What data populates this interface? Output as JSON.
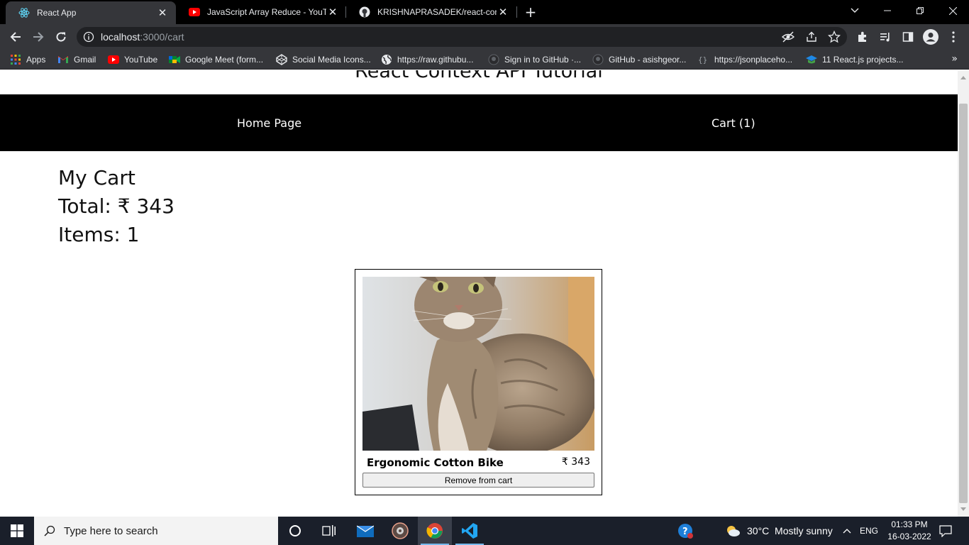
{
  "browser": {
    "tabs": [
      {
        "title": "React App",
        "icon": "react-icon",
        "active": true
      },
      {
        "title": "JavaScript Array Reduce - YouTube",
        "icon": "youtube-icon",
        "active": false
      },
      {
        "title": "KRISHNAPRASADEK/react-context",
        "icon": "github-icon",
        "active": false
      }
    ],
    "url_host": "localhost",
    "url_path": ":3000/cart",
    "bookmarks": [
      {
        "label": "Apps",
        "icon": "apps-grid-icon"
      },
      {
        "label": "Gmail",
        "icon": "gmail-icon"
      },
      {
        "label": "YouTube",
        "icon": "youtube-icon"
      },
      {
        "label": "Google Meet (form...",
        "icon": "google-meet-icon"
      },
      {
        "label": "Social Media Icons...",
        "icon": "codepen-icon"
      },
      {
        "label": "https://raw.githubu...",
        "icon": "globe-icon"
      },
      {
        "label": "Sign in to GitHub ·...",
        "icon": "github-icon"
      },
      {
        "label": "GitHub - asishgeor...",
        "icon": "github-icon"
      },
      {
        "label": "https://jsonplaceho...",
        "icon": "json-icon"
      },
      {
        "label": "11 React.js projects...",
        "icon": "graduation-cap-icon"
      }
    ]
  },
  "page": {
    "heading": "React Context API Tutorial",
    "nav": {
      "home": "Home Page",
      "cart": "Cart (1)"
    },
    "cart": {
      "title": "My Cart",
      "total": "Total: ₹ 343",
      "items": "Items: 1"
    },
    "product": {
      "name": "Ergonomic Cotton Bike",
      "price": "₹ 343",
      "button": "Remove from cart",
      "image": "cat-photo"
    }
  },
  "taskbar": {
    "search_placeholder": "Type here to search",
    "weather": "30°C  Mostly sunny",
    "language": "ENG",
    "time": "01:33 PM",
    "date": "16-03-2022"
  },
  "colors": {
    "navbar": "#000000",
    "chrome_dark": "#35363a",
    "taskbar": "#1a1f2a"
  }
}
